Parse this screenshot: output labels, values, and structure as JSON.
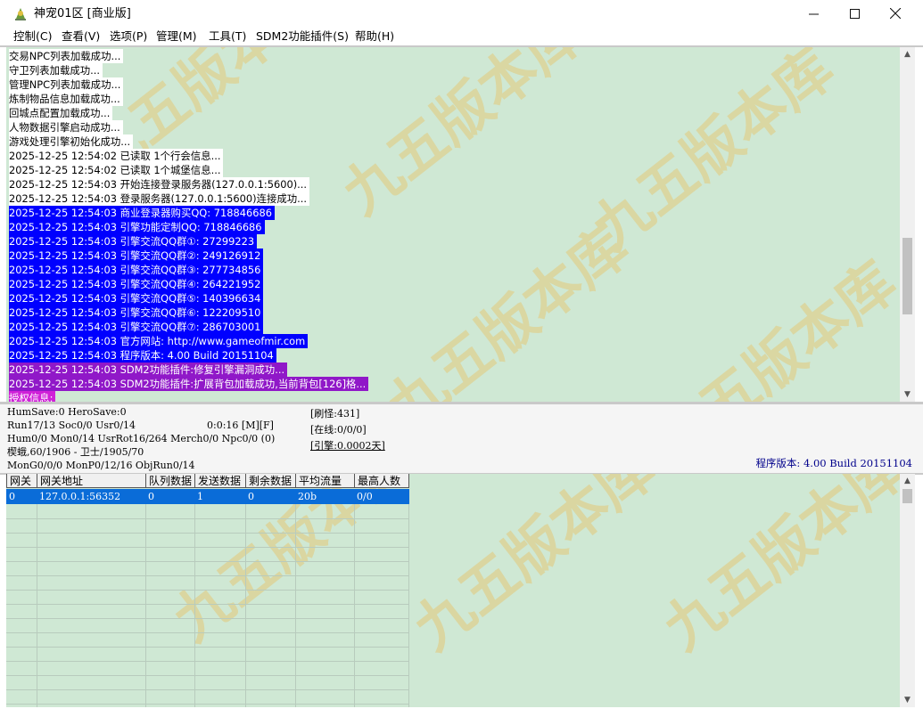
{
  "window": {
    "title": "神宠01区 [商业版]",
    "minimize": "—",
    "maximize": "☐",
    "close": "✕"
  },
  "menu": [
    {
      "label": "控制(C)"
    },
    {
      "label": "查看(V)"
    },
    {
      "label": "选项(P)"
    },
    {
      "label": "管理(M)"
    },
    {
      "label": "工具(T)"
    },
    {
      "label": "SDM2功能插件(S)"
    },
    {
      "label": "帮助(H)"
    }
  ],
  "log": [
    {
      "text": "交易NPC列表加载成功...",
      "style": "white"
    },
    {
      "text": "守卫列表加载成功...",
      "style": "white"
    },
    {
      "text": "管理NPC列表加载成功...",
      "style": "white"
    },
    {
      "text": "炼制物品信息加载成功...",
      "style": "white"
    },
    {
      "text": "回城点配置加载成功...",
      "style": "white"
    },
    {
      "text": "人物数据引擎启动成功...",
      "style": "white"
    },
    {
      "text": "游戏处理引擎初始化成功...",
      "style": "white"
    },
    {
      "text": "2025-12-25 12:54:02 已读取 1个行会信息...",
      "style": "white"
    },
    {
      "text": "2025-12-25 12:54:02 已读取 1个城堡信息...",
      "style": "white"
    },
    {
      "text": "2025-12-25 12:54:03 开始连接登录服务器(127.0.0.1:5600)...",
      "style": "white"
    },
    {
      "text": "2025-12-25 12:54:03 登录服务器(127.0.0.1:5600)连接成功...",
      "style": "white"
    },
    {
      "text": "2025-12-25 12:54:03 商业登录器购买QQ: 718846686",
      "style": "blue"
    },
    {
      "text": "2025-12-25 12:54:03 引擎功能定制QQ: 718846686",
      "style": "blue"
    },
    {
      "text": "2025-12-25 12:54:03 引擎交流QQ群①: 27299223",
      "style": "blue"
    },
    {
      "text": "2025-12-25 12:54:03 引擎交流QQ群②: 249126912",
      "style": "blue"
    },
    {
      "text": "2025-12-25 12:54:03 引擎交流QQ群③: 277734856",
      "style": "blue"
    },
    {
      "text": "2025-12-25 12:54:03 引擎交流QQ群④: 264221952",
      "style": "blue"
    },
    {
      "text": "2025-12-25 12:54:03 引擎交流QQ群⑤: 140396634",
      "style": "blue"
    },
    {
      "text": "2025-12-25 12:54:03 引擎交流QQ群⑥: 122209510",
      "style": "blue"
    },
    {
      "text": "2025-12-25 12:54:03 引擎交流QQ群⑦: 286703001",
      "style": "blue"
    },
    {
      "text": "2025-12-25 12:54:03 官方网站: http://www.gameofmir.com",
      "style": "blue"
    },
    {
      "text": "2025-12-25 12:54:03 程序版本: 4.00 Build 20151104",
      "style": "blue"
    },
    {
      "text": "2025-12-25 12:54:03 SDM2功能插件:修复引擎漏洞成功...",
      "style": "purple"
    },
    {
      "text": "2025-12-25 12:54:03 SDM2功能插件:扩展背包加载成功,当前背包[126]格...",
      "style": "purple"
    },
    {
      "text": "授权信息:",
      "style": "mag"
    }
  ],
  "status": {
    "line1": "HumSave:0 HeroSave:0",
    "line2": "Run17/13 Soc0/0 Usr0/14",
    "line2b": "0:0:16 [M][F]",
    "line3": "Hum0/0 Mon0/14 UsrRot16/264 Merch0/0 Npc0/0 (0)",
    "line4": "楔蛾,60/1906 - 卫士/1905/70",
    "line5": "MonG0/0/0 MonP0/12/16 ObjRun0/14",
    "refresh": "[刷怪:431]",
    "online": "[在线:0/0/0]",
    "engine": "[引擎:0.0002天]",
    "version": "程序版本: 4.00 Build 20151104"
  },
  "gate_table": {
    "headers": [
      "网关",
      "网关地址",
      "队列数据",
      "发送数据",
      "剩余数据",
      "平均流量",
      "最高人数"
    ],
    "rows": [
      [
        "0",
        "127.0.0.1:56352",
        "0",
        "1",
        "0",
        "20b",
        "0/0"
      ]
    ]
  },
  "colors": {
    "panel_bg": "#cfe8d4",
    "log_blue": "#0000ff",
    "log_purple": "#9018c8",
    "selection": "#0a6cd8",
    "version_text": "#00008b"
  },
  "icons": {
    "app": "app-icon",
    "scroll_up": "scroll-up-icon",
    "scroll_down": "scroll-down-icon"
  }
}
